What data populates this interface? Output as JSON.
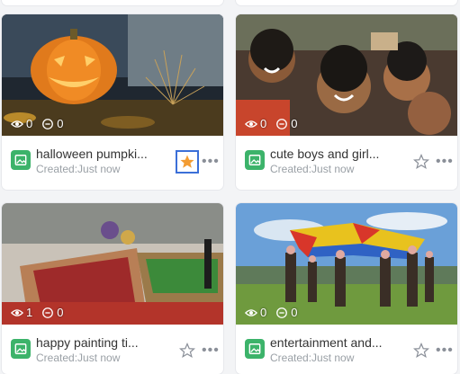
{
  "cards": [
    {
      "title": "halloween pumpki...",
      "created": "Created:Just now",
      "views": "0",
      "comments": "0",
      "favorite": true
    },
    {
      "title": "cute boys and girl...",
      "created": "Created:Just now",
      "views": "0",
      "comments": "0",
      "favorite": false
    },
    {
      "title": "happy painting ti...",
      "created": "Created:Just now",
      "views": "1",
      "comments": "0",
      "favorite": false
    },
    {
      "title": "entertainment and...",
      "created": "Created:Just now",
      "views": "0",
      "comments": "0",
      "favorite": false
    }
  ],
  "colors": {
    "badge": "#3cb36a",
    "star_active": "#f39c33",
    "focus_outline": "#3b6fd8"
  }
}
